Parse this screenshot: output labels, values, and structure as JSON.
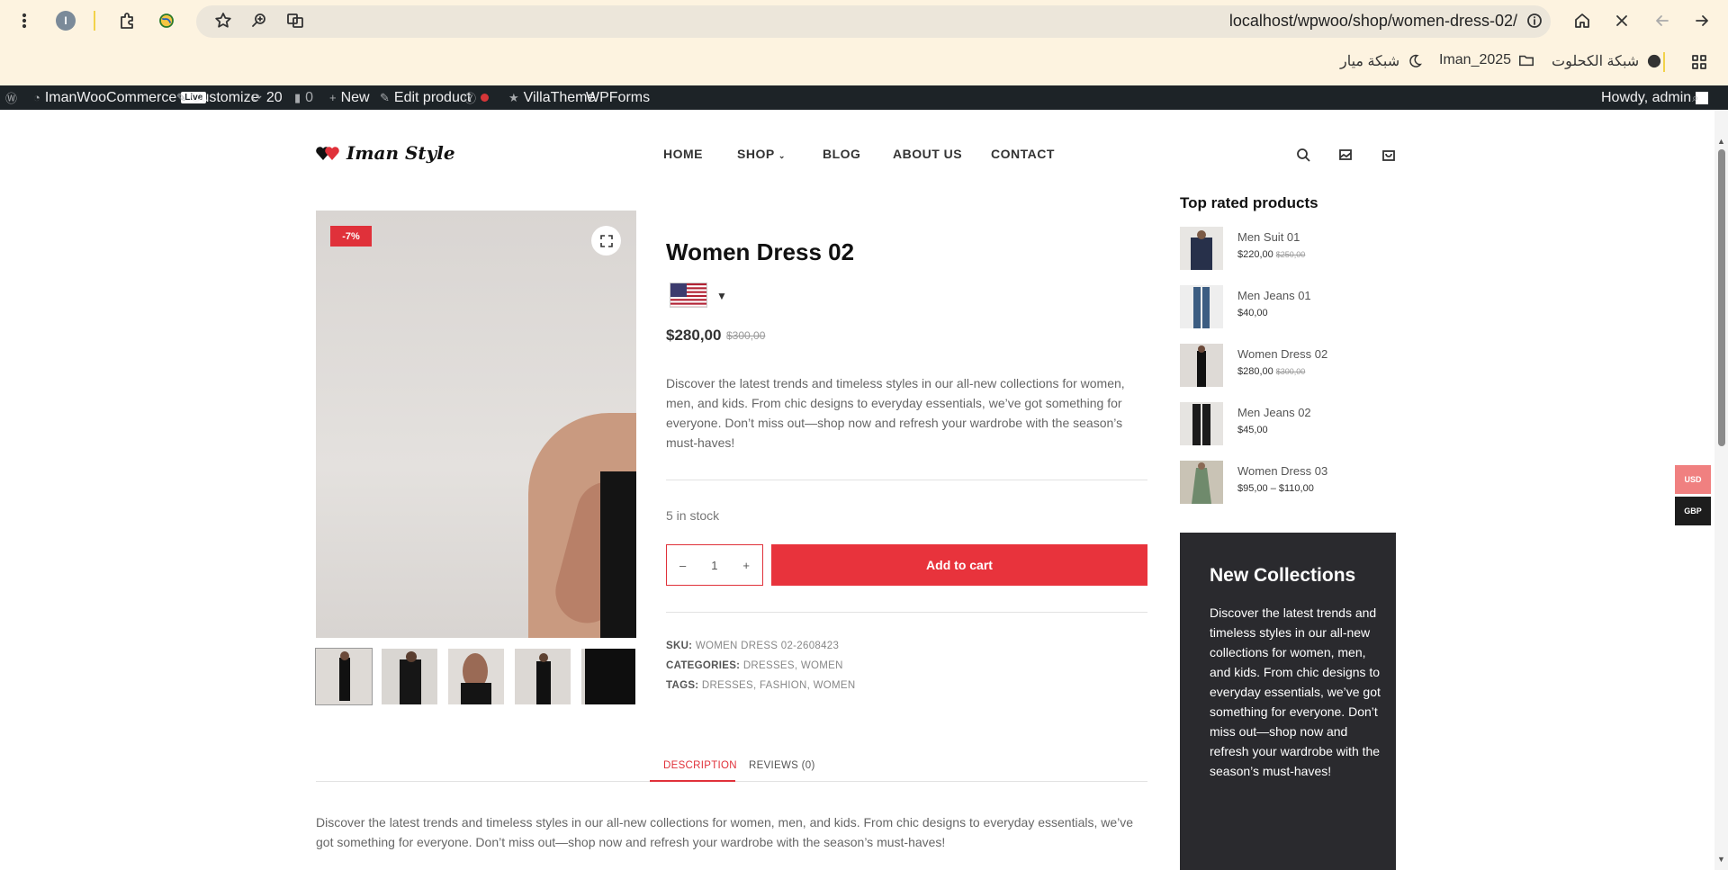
{
  "browser": {
    "url": "localhost/wpwoo/shop/women-dress-02/",
    "profile_initial": "I",
    "bookmarks": [
      "شبكة الكحلوت",
      "Iman_2025",
      "شبكة ميار"
    ]
  },
  "adminbar": {
    "site_name": "ImanWooCommerce",
    "live_badge": "Live",
    "customize": "Customize",
    "updates_count": "20",
    "comments_count": "0",
    "new": "New",
    "edit_product": "Edit product",
    "villatheme": "VillaTheme",
    "wpforms": "WPForms",
    "howdy": "Howdy, admin"
  },
  "header": {
    "logo_text": "Iman Style",
    "nav": [
      "HOME",
      "SHOP",
      "BLOG",
      "ABOUT US",
      "CONTACT"
    ]
  },
  "product": {
    "sale_badge": "-7%",
    "title": "Women Dress 02",
    "currency_flag": "us-flag",
    "price": "$280,00",
    "regular_price": "$300,00",
    "short_description": "Discover the latest trends and timeless styles in our all-new collections for women, men, and kids. From chic designs to everyday essentials, we’ve got something for everyone. Don’t miss out—shop now and refresh your wardrobe with the season’s must-haves!",
    "stock": "5 in stock",
    "quantity": "1",
    "qty_minus": "–",
    "qty_plus": "+",
    "add_to_cart": "Add to cart",
    "sku_label": "SKU:",
    "sku_value": "WOMEN DRESS 02-2608423",
    "categories_label": "CATEGORIES:",
    "categories": [
      "DRESSES",
      "WOMEN"
    ],
    "tags_label": "TAGS:",
    "tags": [
      "DRESSES",
      "FASHION",
      "WOMEN"
    ],
    "sep": ","
  },
  "tabs": {
    "description": "DESCRIPTION",
    "reviews": "REVIEWS (0)",
    "content": "Discover the latest trends and timeless styles in our all-new collections for women, men, and kids. From chic designs to everyday essentials, we’ve got something for everyone. Don’t miss out—shop now and refresh your wardrobe with the season’s must-haves!"
  },
  "sidebar": {
    "top_rated_title": "Top rated products",
    "top_rated": [
      {
        "name": "Men Suit 01",
        "price": "$220,00",
        "old_price": "$250,00"
      },
      {
        "name": "Men Jeans 01",
        "price": "$40,00",
        "old_price": ""
      },
      {
        "name": "Women Dress 02",
        "price": "$280,00",
        "old_price": "$300,00"
      },
      {
        "name": "Men Jeans 02",
        "price": "$45,00",
        "old_price": ""
      },
      {
        "name": "Women Dress 03",
        "price": "$95,00 – $110,00",
        "old_price": ""
      }
    ],
    "promo_title": "New Collections",
    "promo_text": "Discover the latest trends and timeless styles in our all-new collections for women, men, and kids. From chic designs to everyday essentials, we’ve got something for everyone. Don’t miss out—shop now and refresh your wardrobe with the season’s must-haves!"
  },
  "currency_switcher": [
    "USD",
    "GBP"
  ],
  "colors": {
    "accent": "#e8333c",
    "adminbar": "#1d2327",
    "promo_bg": "#2a2a2e",
    "usd_active": "#f08080",
    "gbp_bg": "#1d1d1d"
  }
}
